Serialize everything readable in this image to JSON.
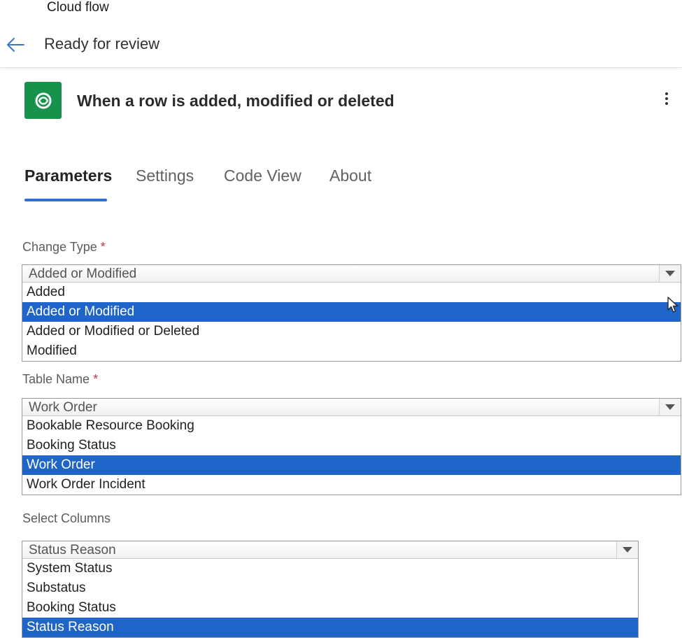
{
  "app": {
    "title": "Cloud flow"
  },
  "header": {
    "title": "Ready for review"
  },
  "trigger": {
    "title": "When a row is added, modified or deleted",
    "icon": "dataverse-icon"
  },
  "tabs": [
    {
      "label": "Parameters",
      "active": true
    },
    {
      "label": "Settings",
      "active": false
    },
    {
      "label": "Code View",
      "active": false
    },
    {
      "label": "About",
      "active": false
    }
  ],
  "fields": {
    "change_type": {
      "label": "Change Type",
      "required_mark": "*",
      "value": "Added or Modified",
      "options": [
        "Added",
        "Added or Modified",
        "Added or Modified or Deleted",
        "Modified"
      ],
      "selected": "Added or Modified"
    },
    "table_name": {
      "label": "Table Name",
      "required_mark": "*",
      "value": "Work Order",
      "options": [
        "Bookable Resource Booking",
        "Booking Status",
        "Work Order",
        "Work Order Incident"
      ],
      "selected": "Work Order"
    },
    "select_columns": {
      "label": "Select Columns",
      "value": "Status Reason",
      "options": [
        "System Status",
        "Substatus",
        "Booking Status",
        "Status Reason"
      ],
      "selected": "Status Reason"
    }
  },
  "colors": {
    "accent": "#2f6fd6",
    "selection": "#1f64c9",
    "trigger_bg": "#17924b"
  }
}
